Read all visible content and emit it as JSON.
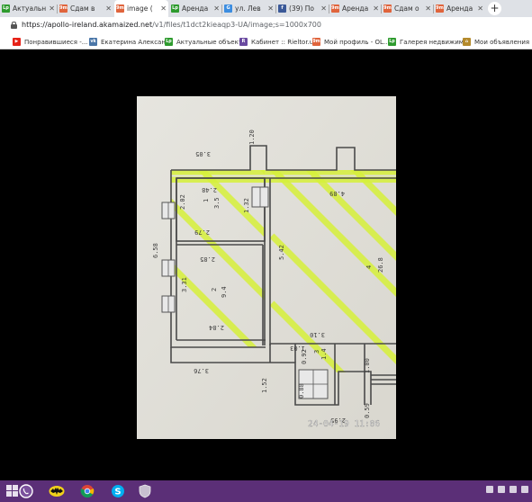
{
  "tabs": [
    {
      "label": "Актуальн",
      "fav": "Lp",
      "color": "#2e9b2e",
      "active": false
    },
    {
      "label": "Сдам в",
      "fav": "9m",
      "color": "#e0643c",
      "active": false
    },
    {
      "label": "image (",
      "fav": "9m",
      "color": "#e0643c",
      "active": true
    },
    {
      "label": "Аренда",
      "fav": "Lp",
      "color": "#2e9b2e",
      "active": false
    },
    {
      "label": "ул. Лев",
      "fav": "G",
      "color": "#3c8de0",
      "active": false
    },
    {
      "label": "(39) По",
      "fav": "f",
      "color": "#3b5998",
      "active": false
    },
    {
      "label": "Аренда",
      "fav": "9m",
      "color": "#e0643c",
      "active": false
    },
    {
      "label": "Сдам о",
      "fav": "9m",
      "color": "#e0643c",
      "active": false
    },
    {
      "label": "Аренда",
      "fav": "9m",
      "color": "#e0643c",
      "active": false
    }
  ],
  "url": {
    "host": "https://apollo-ireland.akamaized.net",
    "path": "/v1/files/t1dct2kieaqp3-UA/image;s=1000x700"
  },
  "bookmarks": [
    {
      "label": "Понравившиеся -...",
      "icon": "youtube-icon",
      "color": "#e62117",
      "fav": "▶"
    },
    {
      "label": "Екатерина Алексан...",
      "icon": "vk-icon",
      "color": "#4a76a8",
      "fav": "vk"
    },
    {
      "label": "Актуальные объект...",
      "icon": "lp-icon",
      "color": "#2e9b2e",
      "fav": "Lp"
    },
    {
      "label": "Кабинет :: Rieltor.ua",
      "icon": "rieltor-icon",
      "color": "#6a4aa0",
      "fav": "R"
    },
    {
      "label": "Мой профиль - OL...",
      "icon": "olx-icon",
      "color": "#e0643c",
      "fav": "9m"
    },
    {
      "label": "Галерея недвижим...",
      "icon": "lp-icon",
      "color": "#2e9b2e",
      "fav": "Lp"
    },
    {
      "label": "Мои объявления н...",
      "icon": "home-icon",
      "color": "#b48a2c",
      "fav": "⌂"
    }
  ],
  "plan": {
    "labels": {
      "d305": "3.05",
      "d120": "1.20",
      "d248": "2.48",
      "d489": "4.89",
      "d202": "2.02",
      "r1": "1",
      "a35": "3.5",
      "d132": "1.32",
      "d279": "2.79",
      "d285": "2.85",
      "d542": "5.42",
      "d658": "6.58",
      "d331": "3.31",
      "r2": "2",
      "a94": "9.4",
      "r4": "4",
      "a268": "26.8",
      "d284": "2.84",
      "d310": "3.10",
      "d103": "1.03",
      "d092": "0.92",
      "r3": "3",
      "a14": "1.4",
      "d376": "3.76",
      "d088": "0.88",
      "d100": "1.00",
      "d152": "1.52",
      "d295": "2.95",
      "d059": "0.59"
    },
    "timestamp": "24-04-19 11:06"
  },
  "taskbar": [
    "start-button",
    "viber-icon",
    "batman-icon",
    "chrome-icon",
    "skype-icon",
    "shield-icon"
  ],
  "colors": {
    "highlighter": "#d6f03a",
    "taskbar": "#5b2f77",
    "paper": "#e4e2dc"
  }
}
